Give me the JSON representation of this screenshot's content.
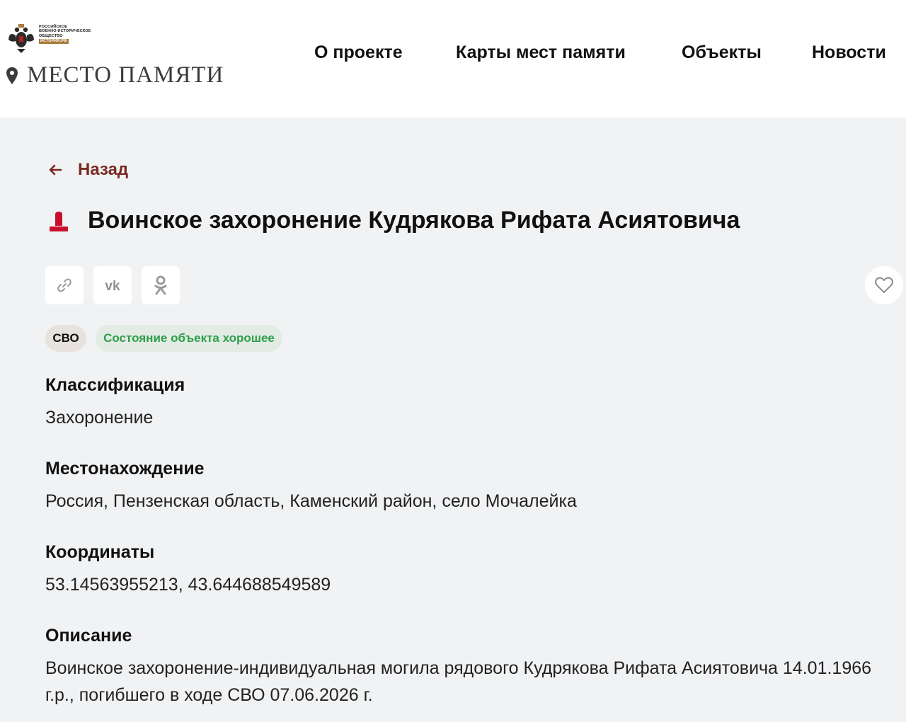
{
  "header": {
    "org_lines": [
      "РОССИЙСКОЕ",
      "ВОЕННО-ИСТОРИЧЕСКОЕ",
      "ОБЩЕСТВО"
    ],
    "org_badge": "ИСТОРИЯ.РФ",
    "site_name": "МЕСТО ПАМЯТИ",
    "nav": [
      "О проекте",
      "Карты мест памяти",
      "Объекты",
      "Новости"
    ]
  },
  "page": {
    "back_label": "Назад",
    "title": "Воинское захоронение Кудрякова Рифата Асиятовича",
    "tags": {
      "svo": "СВО",
      "state": "Состояние объекта хорошее",
      "state_color": "#2e9e4a"
    },
    "sections": [
      {
        "label": "Классификация",
        "value": "Захоронение"
      },
      {
        "label": "Местонахождение",
        "value": "Россия, Пензенская область, Каменский район, село Мочалейка"
      },
      {
        "label": "Координаты",
        "value": "53.14563955213, 43.644688549589"
      },
      {
        "label": "Описание",
        "value": "Воинское захоронение-индивидуальная могила рядового Кудрякова Рифата Асиятовича 14.01.1966 г.р., погибшего в ходе СВО 07.06.2026 г."
      }
    ]
  },
  "icons": {
    "share": [
      "link-icon",
      "vk-icon",
      "odnoklassniki-icon"
    ],
    "favorite": "heart-icon",
    "object_type": "grave-marker-icon",
    "back": "arrow-left-icon"
  },
  "colors": {
    "accent": "#7a2a22",
    "marker": "#c8102e",
    "background": "#f1f2f4"
  }
}
